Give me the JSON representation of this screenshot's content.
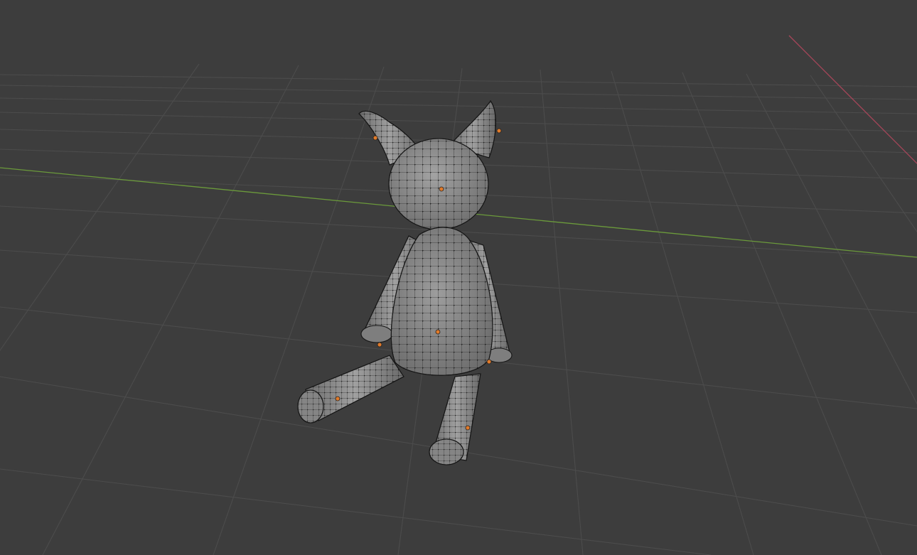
{
  "viewport": {
    "mode": "Edit Mode",
    "shading": "Solid",
    "background_color": "#3d3d3d",
    "grid_color": "#4c4c4c",
    "x_axis_color": "#a8465a",
    "y_axis_color": "#6b9a3b",
    "mesh_fill_color": "#8a8a8a",
    "vertex_color": "#111111",
    "object_origin_color": "#e07a2a"
  },
  "scene": {
    "object": {
      "name_icon": "mesh-object-icon",
      "parts": [
        "left-ear",
        "right-ear",
        "head",
        "body",
        "left-arm",
        "right-arm",
        "left-leg",
        "right-leg"
      ]
    }
  }
}
